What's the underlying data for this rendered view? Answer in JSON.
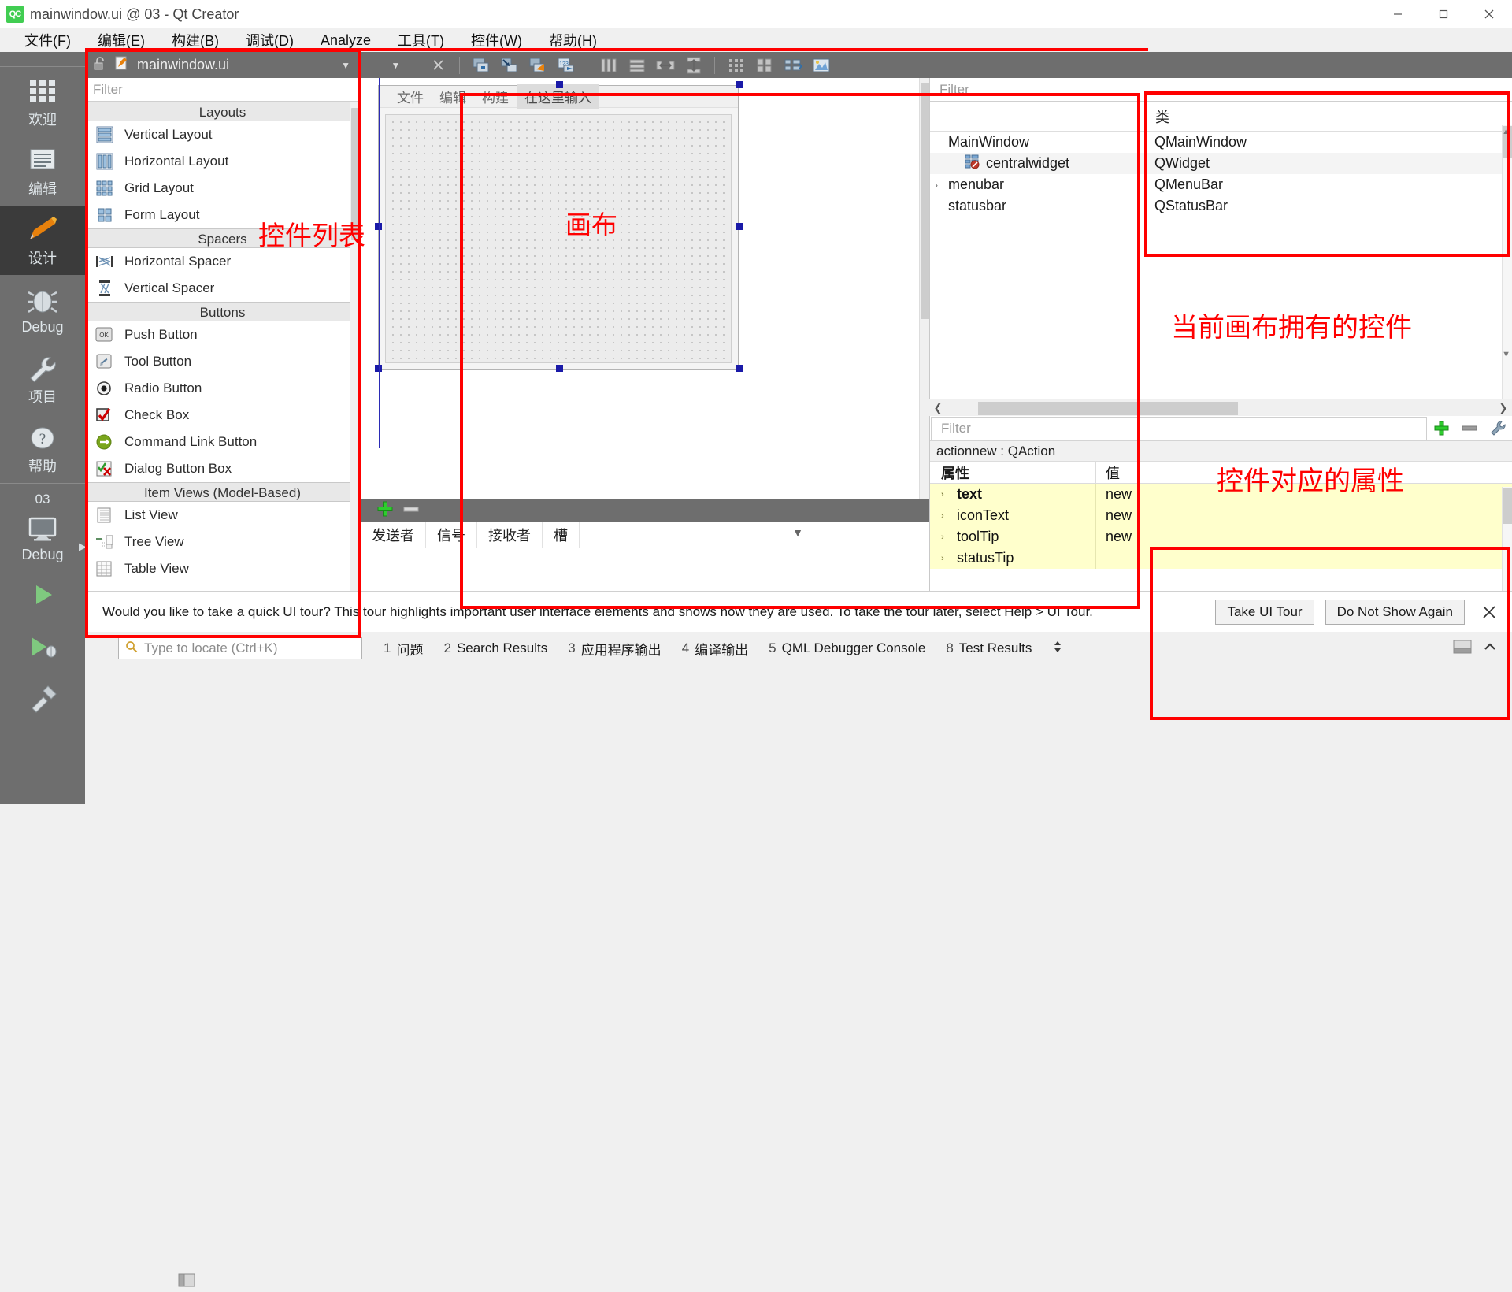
{
  "titlebar": {
    "logo_text": "QC",
    "title": "mainwindow.ui @ 03 - Qt Creator",
    "minimize": "─",
    "maximize": "☐",
    "close": "✕"
  },
  "menubar": {
    "items": [
      {
        "label": "文件(F)"
      },
      {
        "label": "编辑(E)"
      },
      {
        "label": "构建(B)"
      },
      {
        "label": "调试(D)"
      },
      {
        "label": "Analyze"
      },
      {
        "label": "工具(T)"
      },
      {
        "label": "控件(W)"
      },
      {
        "label": "帮助(H)"
      }
    ]
  },
  "modebar": {
    "modes": [
      {
        "label": "欢迎",
        "icon": "grid-icon",
        "active": false
      },
      {
        "label": "编辑",
        "icon": "document-lines-icon",
        "active": false
      },
      {
        "label": "设计",
        "icon": "pencil-icon",
        "active": true
      },
      {
        "label": "Debug",
        "icon": "bug-icon",
        "active": false
      },
      {
        "label": "项目",
        "icon": "wrench-icon",
        "active": false
      },
      {
        "label": "帮助",
        "icon": "question-circle-icon",
        "active": false
      }
    ],
    "kit_name": "03",
    "kit_mode": "Debug",
    "kit_icon": "monitor-icon",
    "run_icon": "play-green-icon",
    "debug_icon": "play-debug-icon",
    "build_icon": "hammer-icon"
  },
  "widgetbox": {
    "header_title": "mainwindow.ui",
    "lock_icon": "unlock-icon",
    "file_icon": "ui-file-icon",
    "caret_icon": "chevron-down-icon",
    "close_icon": "close-icon",
    "filter_placeholder": "Filter",
    "groups": [
      {
        "name": "Layouts",
        "items": [
          {
            "label": "Vertical Layout",
            "icon": "vertical-layout-icon"
          },
          {
            "label": "Horizontal Layout",
            "icon": "horizontal-layout-icon"
          },
          {
            "label": "Grid Layout",
            "icon": "grid-layout-icon"
          },
          {
            "label": "Form Layout",
            "icon": "form-layout-icon"
          }
        ]
      },
      {
        "name": "Spacers",
        "items": [
          {
            "label": "Horizontal Spacer",
            "icon": "horizontal-spacer-icon"
          },
          {
            "label": "Vertical Spacer",
            "icon": "vertical-spacer-icon"
          }
        ]
      },
      {
        "name": "Buttons",
        "items": [
          {
            "label": "Push Button",
            "icon": "push-button-icon"
          },
          {
            "label": "Tool Button",
            "icon": "tool-button-icon"
          },
          {
            "label": "Radio Button",
            "icon": "radio-button-icon"
          },
          {
            "label": "Check Box",
            "icon": "check-box-icon"
          },
          {
            "label": "Command Link Button",
            "icon": "command-link-icon"
          },
          {
            "label": "Dialog Button Box",
            "icon": "dialog-button-box-icon"
          }
        ]
      },
      {
        "name": "Item Views (Model-Based)",
        "items": [
          {
            "label": "List View",
            "icon": "list-view-icon"
          },
          {
            "label": "Tree View",
            "icon": "tree-view-icon"
          },
          {
            "label": "Table View",
            "icon": "table-view-icon"
          }
        ]
      }
    ]
  },
  "designer_toolbar": {
    "buttons": [
      {
        "name": "edit-widgets-icon"
      },
      {
        "name": "edit-signals-slots-icon"
      },
      {
        "name": "edit-buddies-icon"
      },
      {
        "name": "edit-tab-order-icon"
      },
      {
        "name": "layout-horizontally-icon"
      },
      {
        "name": "layout-vertically-icon"
      },
      {
        "name": "layout-splitter-horizontal-icon"
      },
      {
        "name": "layout-splitter-vertical-icon"
      },
      {
        "name": "layout-in-form-icon"
      },
      {
        "name": "layout-grid-icon"
      },
      {
        "name": "break-layout-icon"
      },
      {
        "name": "adjust-size-icon"
      }
    ]
  },
  "form": {
    "menus": [
      "文件",
      "编辑",
      "构建"
    ],
    "placeholder_menu": "在这里输入"
  },
  "annotations": {
    "widget_list": "控件列表",
    "canvas": "画布",
    "current_widgets": "当前画布拥有的控件",
    "properties": "控件对应的属性",
    "color": "#ff0000"
  },
  "signal_slot": {
    "add_icon": "plus-green-icon",
    "remove_icon": "minus-icon",
    "columns": [
      "发送者",
      "信号",
      "接收者",
      "槽"
    ],
    "expander_icon": "chevron-down-icon"
  },
  "inspector": {
    "filter_placeholder": "Filter",
    "columns": {
      "object": "",
      "class": "类"
    },
    "rows": [
      {
        "name": "MainWindow",
        "cls": "QMainWindow",
        "indent": 0,
        "twisty": "",
        "icon": ""
      },
      {
        "name": "centralwidget",
        "cls": "QWidget",
        "indent": 1,
        "twisty": "",
        "icon": "central-widget-icon"
      },
      {
        "name": "menubar",
        "cls": "QMenuBar",
        "indent": 0,
        "twisty": "›",
        "icon": ""
      },
      {
        "name": "statusbar",
        "cls": "QStatusBar",
        "indent": 1,
        "twisty": "",
        "icon": ""
      }
    ],
    "scroll_up_icon": "caret-up-icon",
    "scroll_down_icon": "caret-down-icon",
    "hscroll_left_icon": "caret-left-icon",
    "hscroll_right_icon": "caret-right-icon"
  },
  "property_editor": {
    "filter_placeholder": "Filter",
    "add_icon": "plus-green-icon",
    "remove_icon": "minus-icon",
    "config_icon": "wrench-icon",
    "object_line": "actionnew : QAction",
    "columns": {
      "key": "属性",
      "value": "值"
    },
    "rows": [
      {
        "key": "text",
        "value": "new",
        "bold": true,
        "twisty": "›"
      },
      {
        "key": "iconText",
        "value": "new",
        "bold": false,
        "twisty": "›"
      },
      {
        "key": "toolTip",
        "value": "new",
        "bold": false,
        "twisty": "›"
      },
      {
        "key": "statusTip",
        "value": "",
        "bold": false,
        "twisty": "›"
      }
    ]
  },
  "tour": {
    "message": "Would you like to take a quick UI tour? This tour highlights important user interface elements and shows how they are used. To take the tour later, select Help > UI Tour.",
    "take_tour": "Take UI Tour",
    "do_not_show": "Do Not Show Again",
    "close_icon": "close-icon"
  },
  "output_bar": {
    "sidebar_icon": "sidebar-toggle-icon",
    "locator_icon": "search-icon",
    "locator_placeholder": "Type to locate (Ctrl+K)",
    "panes": [
      {
        "num": "1",
        "label": "问题"
      },
      {
        "num": "2",
        "label": "Search Results"
      },
      {
        "num": "3",
        "label": "应用程序输出"
      },
      {
        "num": "4",
        "label": "编译输出"
      },
      {
        "num": "5",
        "label": "QML Debugger Console"
      },
      {
        "num": "8",
        "label": "Test Results"
      }
    ],
    "updown_icon": "updown-arrows-icon",
    "minimize_icon": "minimize-pane-icon",
    "maximize_icon": "maximize-pane-icon"
  }
}
